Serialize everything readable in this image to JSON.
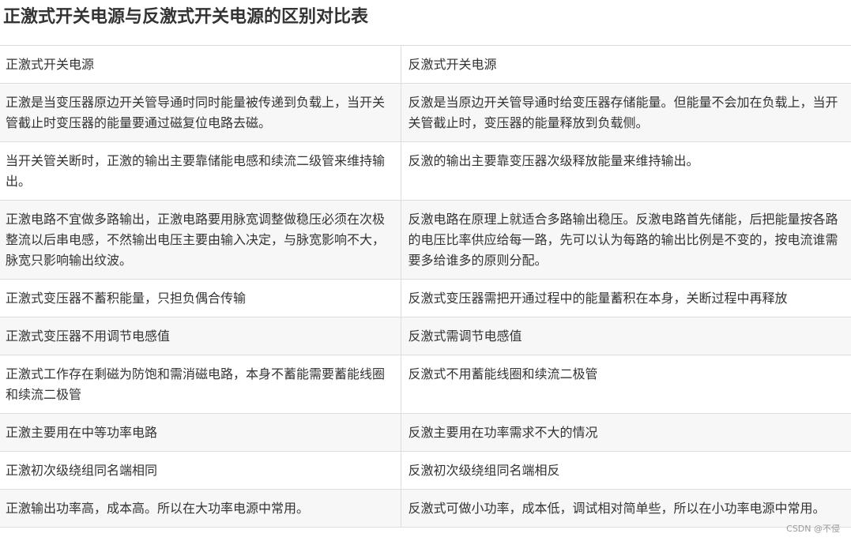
{
  "title": "正激式开关电源与反激式开关电源的区别对比表",
  "table": {
    "header": [
      "正激式开关电源",
      "反激式开关电源"
    ],
    "rows": [
      [
        "正激是当变压器原边开关管导通时同时能量被传递到负载上，当开关管截止时变压器的能量要通过磁复位电路去磁。",
        "反激是当原边开关管导通时给变压器存储能量。但能量不会加在负载上，当开关管截止时，变压器的能量释放到负载侧。"
      ],
      [
        "当开关管关断时，正激的输出主要靠储能电感和续流二级管来维持输出。",
        "反激的输出主要靠变压器次级释放能量来维持输出。"
      ],
      [
        "正激电路不宜做多路输出，正激电路要用脉宽调整做稳压必须在次极整流以后串电感，不然输出电压主要由输入决定，与脉宽影响不大，脉宽只影响输出纹波。",
        "反激电路在原理上就适合多路输出稳压。反激电路首先储能，后把能量按各路的电压比率供应给每一路，先可以认为每路的输出比例是不变的，按电流谁需要多给谁多的原则分配。"
      ],
      [
        "正激式变压器不蓄积能量，只担负偶合传输",
        "反激式变压器需把开通过程中的能量蓄积在本身，关断过程中再释放"
      ],
      [
        "正激式变压器不用调节电感值",
        "反激式需调节电感值"
      ],
      [
        "正激式工作存在剩磁为防饱和需消磁电路，本身不蓄能需要蓄能线圈和续流二极管",
        "反激式不用蓄能线圈和续流二极管"
      ],
      [
        "正激主要用在中等功率电路",
        "反激主要用在功率需求不大的情况"
      ],
      [
        "正激初次级绕组同名端相同",
        "反激初次级绕组同名端相反"
      ],
      [
        "正激输出功率高，成本高。所以在大功率电源中常用。",
        "反激式可做小功率，成本低，调试相对简单些，所以在小功率电源中常用。"
      ]
    ]
  },
  "watermark": "CSDN @不侵"
}
